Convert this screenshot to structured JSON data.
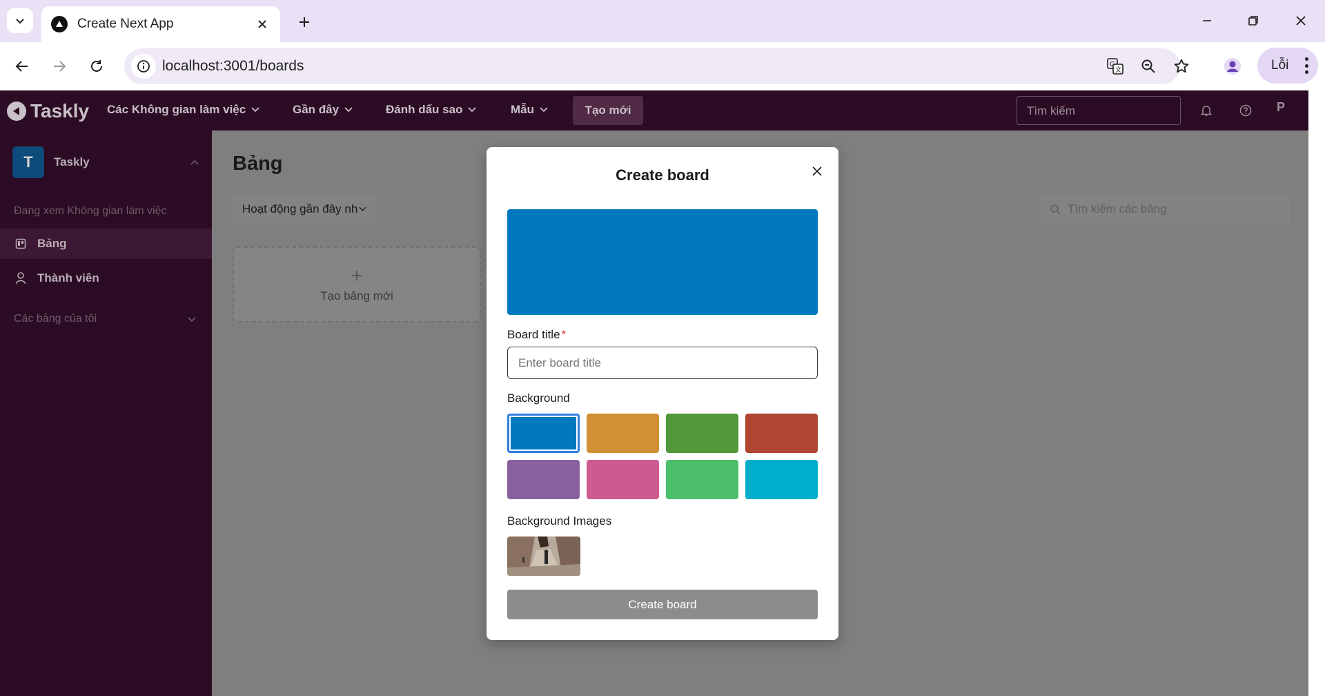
{
  "browser": {
    "tab_title": "Create Next App",
    "url": "localhost:3001/boards",
    "error_chip_label": "Lỗi"
  },
  "header": {
    "logo_text": "Taskly",
    "nav": [
      "Các Không gian làm việc",
      "Gần đây",
      "Đánh dấu sao",
      "Mẫu"
    ],
    "create_label": "Tạo mới",
    "search_placeholder": "Tìm kiếm",
    "avatar_fallback": "P"
  },
  "sidebar": {
    "workspace_initial": "T",
    "workspace_name": "Taskly",
    "viewing_caption": "Đang xem Không gian làm việc",
    "items": [
      {
        "label": "Bảng",
        "icon": "board-icon",
        "active": true
      },
      {
        "label": "Thành viên",
        "icon": "user-icon",
        "active": false
      }
    ],
    "my_boards_label": "Các bảng của tôi"
  },
  "main": {
    "page_title": "Bảng",
    "sort_value": "Hoạt động gần đây nhất",
    "search_placeholder": "Tìm kiếm các bảng",
    "new_board_label": "Tạo bảng mới"
  },
  "modal": {
    "title": "Create board",
    "preview_color": "#0079bf",
    "board_title_label": "Board title",
    "required_mark": "*",
    "board_title_placeholder": "Enter board title",
    "board_title_value": "",
    "background_label": "Background",
    "background_colors": [
      "#0079bf",
      "#d29034",
      "#519839",
      "#b04632",
      "#89609e",
      "#cd5a91",
      "#4bbf6b",
      "#00aecc"
    ],
    "selected_background_index": 0,
    "background_images_label": "Background Images",
    "submit_label": "Create board"
  },
  "colors": {
    "header_bg": "#2c0c24",
    "overlay_main": "#7f7f7f",
    "submit_disabled": "#8c8c8c",
    "selection_outline": "#2f7fe0"
  }
}
